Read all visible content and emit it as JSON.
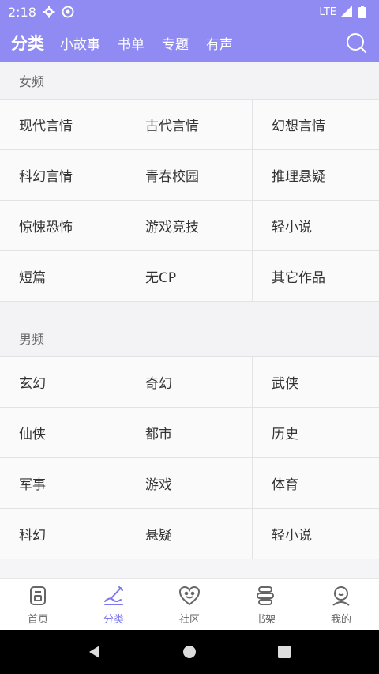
{
  "status": {
    "time": "2:18",
    "network": "LTE"
  },
  "tabs": [
    {
      "label": "分类",
      "active": true
    },
    {
      "label": "小故事"
    },
    {
      "label": "书单"
    },
    {
      "label": "专题"
    },
    {
      "label": "有声"
    }
  ],
  "sections": [
    {
      "title": "女频",
      "items": [
        "现代言情",
        "古代言情",
        "幻想言情",
        "科幻言情",
        "青春校园",
        "推理悬疑",
        "惊悚恐怖",
        "游戏竞技",
        "轻小说",
        "短篇",
        "无CP",
        "其它作品"
      ]
    },
    {
      "title": "男频",
      "items": [
        "玄幻",
        "奇幻",
        "武侠",
        "仙侠",
        "都市",
        "历史",
        "军事",
        "游戏",
        "体育",
        "科幻",
        "悬疑",
        "轻小说"
      ]
    }
  ],
  "bottom_nav": [
    {
      "label": "首页",
      "icon": "home-icon"
    },
    {
      "label": "分类",
      "icon": "category-icon",
      "active": true
    },
    {
      "label": "社区",
      "icon": "community-icon"
    },
    {
      "label": "书架",
      "icon": "bookshelf-icon"
    },
    {
      "label": "我的",
      "icon": "profile-icon"
    }
  ],
  "colors": {
    "accent": "#8f8bf3",
    "active_label": "#7d78ee"
  }
}
